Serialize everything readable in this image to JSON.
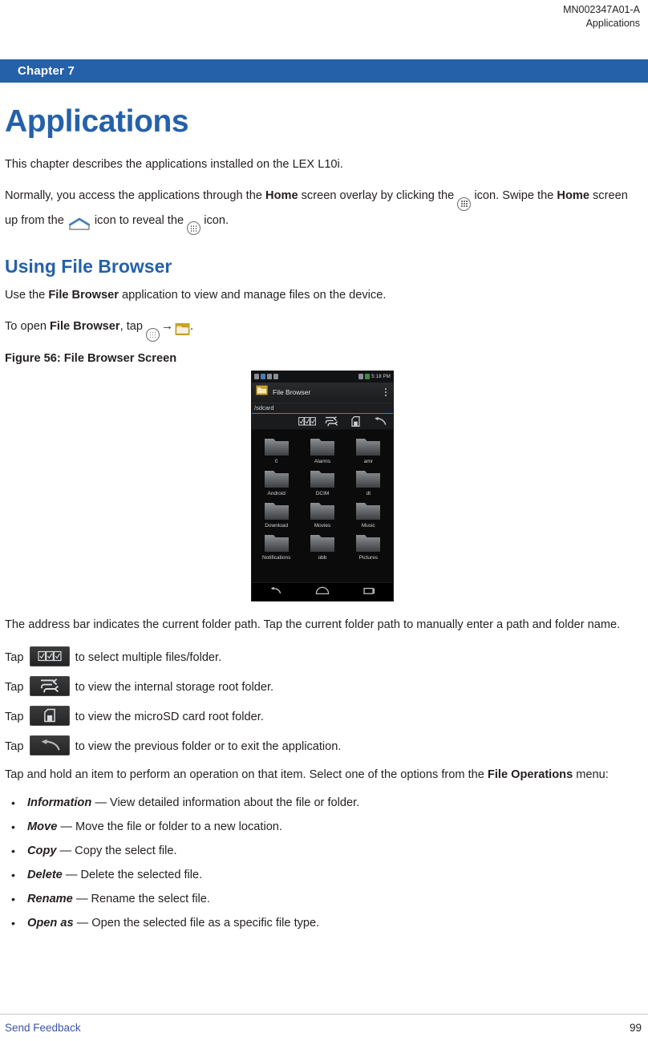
{
  "header": {
    "doc_number": "MN002347A01-A",
    "running_head": "Applications"
  },
  "chapter_band": {
    "label": "Chapter 7"
  },
  "chapter": {
    "title": "Applications",
    "intro": "This chapter describes the applications installed on the LEX L10i.",
    "access_para_1": "Normally, you access the applications through the ",
    "access_home_bold_1": "Home",
    "access_para_2": " screen overlay by clicking the ",
    "access_para_3": " icon. Swipe the ",
    "access_home_bold_2": "Home",
    "access_para_4": " screen up from the ",
    "access_para_5": " icon to reveal the ",
    "access_para_6": " icon."
  },
  "section": {
    "title": "Using File Browser",
    "use_para_1": "Use the ",
    "use_bold": "File Browser",
    "use_para_2": " application to view and manage files on the device.",
    "open_para_1": "To open ",
    "open_bold": "File Browser",
    "open_para_2": ", tap ",
    "open_arrow": "→",
    "open_para_3": ".",
    "figure_caption": "Figure 56: File Browser Screen"
  },
  "screenshot": {
    "status_time": "5:18 PM",
    "app_title": "File Browser",
    "address_bar": "/sdcard",
    "toolbar_icons": [
      "multi-select-icon",
      "internal-storage-icon",
      "microsd-card-icon",
      "back-arrow-icon"
    ],
    "folders": [
      "0",
      "Alarms",
      "amr",
      "Android",
      "DCIM",
      "dt",
      "Download",
      "Movies",
      "Music",
      "Notifications",
      "obb",
      "Pictures"
    ],
    "navbar_icons": [
      "back-icon",
      "home-icon",
      "recents-icon"
    ]
  },
  "address_note": "The address bar indicates the current folder path. Tap the current folder path to manually enter a path and folder name.",
  "tap_lines": [
    {
      "prefix": "Tap ",
      "icon": "multi-select-icon",
      "suffix": " to select multiple files/folder."
    },
    {
      "prefix": "Tap ",
      "icon": "internal-storage-icon",
      "suffix": " to view the internal storage root folder."
    },
    {
      "prefix": "Tap ",
      "icon": "microsd-card-icon",
      "suffix": " to view the microSD card root folder."
    },
    {
      "prefix": "Tap ",
      "icon": "back-arrow-icon",
      "suffix": " to view the previous folder or to exit the application."
    }
  ],
  "file_ops": {
    "lead_1": "Tap and hold an item to perform an operation on that item. Select one of the options from the ",
    "lead_bold": "File Operations",
    "lead_2": " menu:",
    "items": [
      {
        "term": "Information",
        "desc": " — View detailed information about the file or folder."
      },
      {
        "term": "Move",
        "desc": " — Move the file or folder to a new location."
      },
      {
        "term": "Copy",
        "desc": " — Copy the select file."
      },
      {
        "term": "Delete",
        "desc": " — Delete the selected file."
      },
      {
        "term": "Rename",
        "desc": " — Rename the select file."
      },
      {
        "term": "Open as",
        "desc": " — Open the selected file as a specific file type."
      }
    ]
  },
  "footer": {
    "send_feedback": "Send Feedback",
    "page_number": "99"
  },
  "colors": {
    "brand_blue": "#2561a9",
    "link_blue": "#3b55a4",
    "text": "#231f20"
  }
}
